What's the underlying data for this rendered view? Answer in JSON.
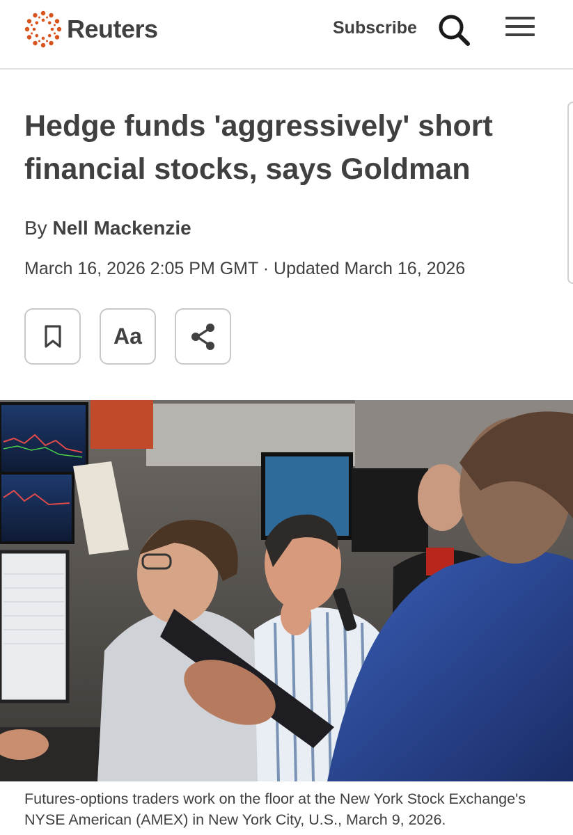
{
  "header": {
    "brand": "Reuters",
    "subscribe_label": "Subscribe",
    "search_icon": "search-icon",
    "menu_icon": "hamburger-menu-icon",
    "brand_color": "#d9531e"
  },
  "article": {
    "headline": "Hedge funds 'aggressively' short financial stocks, says Goldman",
    "byline_prefix": "By",
    "author": "Nell Mackenzie",
    "dateline": "March 16, 2026 2:05 PM GMT · Updated March 16, 2026",
    "actions": {
      "bookmark_icon": "bookmark-icon",
      "text_size_label": "Aa",
      "share_icon": "share-icon"
    },
    "photo_caption": "Futures-options traders work on the floor at the New York Stock Exchange's NYSE American (AMEX) in New York City, U.S., March 9, 2026."
  }
}
